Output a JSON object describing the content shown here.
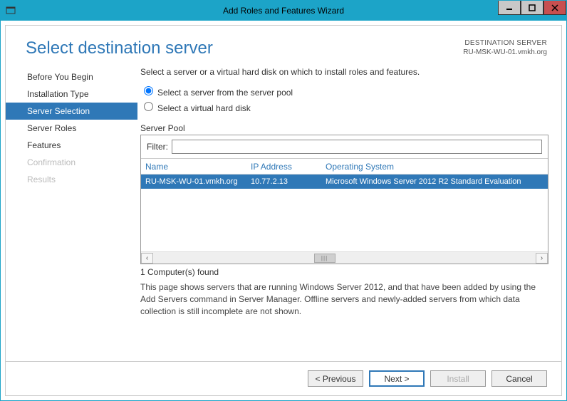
{
  "window": {
    "title": "Add Roles and Features Wizard"
  },
  "header": {
    "page_title": "Select destination server",
    "dest_label": "DESTINATION SERVER",
    "dest_value": "RU-MSK-WU-01.vmkh.org"
  },
  "sidebar": {
    "items": [
      {
        "label": "Before You Begin",
        "state": "normal"
      },
      {
        "label": "Installation Type",
        "state": "normal"
      },
      {
        "label": "Server Selection",
        "state": "selected"
      },
      {
        "label": "Server Roles",
        "state": "normal"
      },
      {
        "label": "Features",
        "state": "normal"
      },
      {
        "label": "Confirmation",
        "state": "disabled"
      },
      {
        "label": "Results",
        "state": "disabled"
      }
    ]
  },
  "content": {
    "intro": "Select a server or a virtual hard disk on which to install roles and features.",
    "radio1": "Select a server from the server pool",
    "radio2": "Select a virtual hard disk",
    "server_pool_label": "Server Pool",
    "filter_label": "Filter:",
    "filter_value": "",
    "columns": {
      "name": "Name",
      "ip": "IP Address",
      "os": "Operating System"
    },
    "rows": [
      {
        "name": "RU-MSK-WU-01.vmkh.org",
        "ip": "10.77.2.13",
        "os": "Microsoft Windows Server 2012 R2 Standard Evaluation"
      }
    ],
    "found": "1 Computer(s) found",
    "description": "This page shows servers that are running Windows Server 2012, and that have been added by using the Add Servers command in Server Manager. Offline servers and newly-added servers from which data collection is still incomplete are not shown."
  },
  "footer": {
    "previous": "< Previous",
    "next": "Next >",
    "install": "Install",
    "cancel": "Cancel"
  }
}
